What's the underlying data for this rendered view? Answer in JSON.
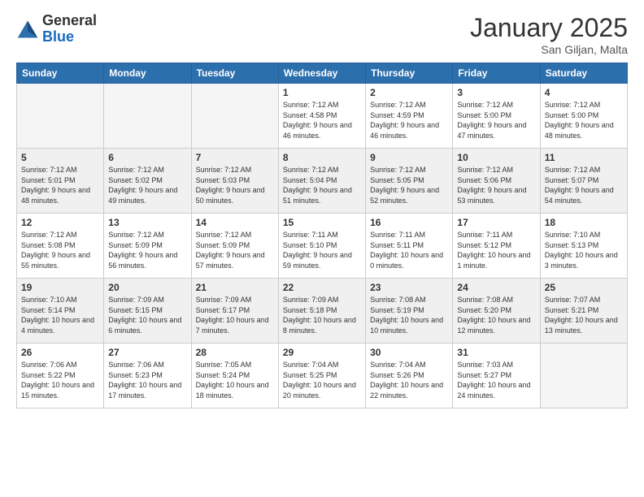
{
  "header": {
    "logo_line1": "General",
    "logo_line2": "Blue",
    "title": "January 2025",
    "subtitle": "San Giljan, Malta"
  },
  "weekdays": [
    "Sunday",
    "Monday",
    "Tuesday",
    "Wednesday",
    "Thursday",
    "Friday",
    "Saturday"
  ],
  "weeks": [
    [
      {
        "day": "",
        "sunrise": "",
        "sunset": "",
        "daylight": "",
        "empty": true
      },
      {
        "day": "",
        "sunrise": "",
        "sunset": "",
        "daylight": "",
        "empty": true
      },
      {
        "day": "",
        "sunrise": "",
        "sunset": "",
        "daylight": "",
        "empty": true
      },
      {
        "day": "1",
        "sunrise": "Sunrise: 7:12 AM",
        "sunset": "Sunset: 4:58 PM",
        "daylight": "Daylight: 9 hours and 46 minutes.",
        "empty": false
      },
      {
        "day": "2",
        "sunrise": "Sunrise: 7:12 AM",
        "sunset": "Sunset: 4:59 PM",
        "daylight": "Daylight: 9 hours and 46 minutes.",
        "empty": false
      },
      {
        "day": "3",
        "sunrise": "Sunrise: 7:12 AM",
        "sunset": "Sunset: 5:00 PM",
        "daylight": "Daylight: 9 hours and 47 minutes.",
        "empty": false
      },
      {
        "day": "4",
        "sunrise": "Sunrise: 7:12 AM",
        "sunset": "Sunset: 5:00 PM",
        "daylight": "Daylight: 9 hours and 48 minutes.",
        "empty": false
      }
    ],
    [
      {
        "day": "5",
        "sunrise": "Sunrise: 7:12 AM",
        "sunset": "Sunset: 5:01 PM",
        "daylight": "Daylight: 9 hours and 48 minutes.",
        "empty": false
      },
      {
        "day": "6",
        "sunrise": "Sunrise: 7:12 AM",
        "sunset": "Sunset: 5:02 PM",
        "daylight": "Daylight: 9 hours and 49 minutes.",
        "empty": false
      },
      {
        "day": "7",
        "sunrise": "Sunrise: 7:12 AM",
        "sunset": "Sunset: 5:03 PM",
        "daylight": "Daylight: 9 hours and 50 minutes.",
        "empty": false
      },
      {
        "day": "8",
        "sunrise": "Sunrise: 7:12 AM",
        "sunset": "Sunset: 5:04 PM",
        "daylight": "Daylight: 9 hours and 51 minutes.",
        "empty": false
      },
      {
        "day": "9",
        "sunrise": "Sunrise: 7:12 AM",
        "sunset": "Sunset: 5:05 PM",
        "daylight": "Daylight: 9 hours and 52 minutes.",
        "empty": false
      },
      {
        "day": "10",
        "sunrise": "Sunrise: 7:12 AM",
        "sunset": "Sunset: 5:06 PM",
        "daylight": "Daylight: 9 hours and 53 minutes.",
        "empty": false
      },
      {
        "day": "11",
        "sunrise": "Sunrise: 7:12 AM",
        "sunset": "Sunset: 5:07 PM",
        "daylight": "Daylight: 9 hours and 54 minutes.",
        "empty": false
      }
    ],
    [
      {
        "day": "12",
        "sunrise": "Sunrise: 7:12 AM",
        "sunset": "Sunset: 5:08 PM",
        "daylight": "Daylight: 9 hours and 55 minutes.",
        "empty": false
      },
      {
        "day": "13",
        "sunrise": "Sunrise: 7:12 AM",
        "sunset": "Sunset: 5:09 PM",
        "daylight": "Daylight: 9 hours and 56 minutes.",
        "empty": false
      },
      {
        "day": "14",
        "sunrise": "Sunrise: 7:12 AM",
        "sunset": "Sunset: 5:09 PM",
        "daylight": "Daylight: 9 hours and 57 minutes.",
        "empty": false
      },
      {
        "day": "15",
        "sunrise": "Sunrise: 7:11 AM",
        "sunset": "Sunset: 5:10 PM",
        "daylight": "Daylight: 9 hours and 59 minutes.",
        "empty": false
      },
      {
        "day": "16",
        "sunrise": "Sunrise: 7:11 AM",
        "sunset": "Sunset: 5:11 PM",
        "daylight": "Daylight: 10 hours and 0 minutes.",
        "empty": false
      },
      {
        "day": "17",
        "sunrise": "Sunrise: 7:11 AM",
        "sunset": "Sunset: 5:12 PM",
        "daylight": "Daylight: 10 hours and 1 minute.",
        "empty": false
      },
      {
        "day": "18",
        "sunrise": "Sunrise: 7:10 AM",
        "sunset": "Sunset: 5:13 PM",
        "daylight": "Daylight: 10 hours and 3 minutes.",
        "empty": false
      }
    ],
    [
      {
        "day": "19",
        "sunrise": "Sunrise: 7:10 AM",
        "sunset": "Sunset: 5:14 PM",
        "daylight": "Daylight: 10 hours and 4 minutes.",
        "empty": false
      },
      {
        "day": "20",
        "sunrise": "Sunrise: 7:09 AM",
        "sunset": "Sunset: 5:15 PM",
        "daylight": "Daylight: 10 hours and 6 minutes.",
        "empty": false
      },
      {
        "day": "21",
        "sunrise": "Sunrise: 7:09 AM",
        "sunset": "Sunset: 5:17 PM",
        "daylight": "Daylight: 10 hours and 7 minutes.",
        "empty": false
      },
      {
        "day": "22",
        "sunrise": "Sunrise: 7:09 AM",
        "sunset": "Sunset: 5:18 PM",
        "daylight": "Daylight: 10 hours and 8 minutes.",
        "empty": false
      },
      {
        "day": "23",
        "sunrise": "Sunrise: 7:08 AM",
        "sunset": "Sunset: 5:19 PM",
        "daylight": "Daylight: 10 hours and 10 minutes.",
        "empty": false
      },
      {
        "day": "24",
        "sunrise": "Sunrise: 7:08 AM",
        "sunset": "Sunset: 5:20 PM",
        "daylight": "Daylight: 10 hours and 12 minutes.",
        "empty": false
      },
      {
        "day": "25",
        "sunrise": "Sunrise: 7:07 AM",
        "sunset": "Sunset: 5:21 PM",
        "daylight": "Daylight: 10 hours and 13 minutes.",
        "empty": false
      }
    ],
    [
      {
        "day": "26",
        "sunrise": "Sunrise: 7:06 AM",
        "sunset": "Sunset: 5:22 PM",
        "daylight": "Daylight: 10 hours and 15 minutes.",
        "empty": false
      },
      {
        "day": "27",
        "sunrise": "Sunrise: 7:06 AM",
        "sunset": "Sunset: 5:23 PM",
        "daylight": "Daylight: 10 hours and 17 minutes.",
        "empty": false
      },
      {
        "day": "28",
        "sunrise": "Sunrise: 7:05 AM",
        "sunset": "Sunset: 5:24 PM",
        "daylight": "Daylight: 10 hours and 18 minutes.",
        "empty": false
      },
      {
        "day": "29",
        "sunrise": "Sunrise: 7:04 AM",
        "sunset": "Sunset: 5:25 PM",
        "daylight": "Daylight: 10 hours and 20 minutes.",
        "empty": false
      },
      {
        "day": "30",
        "sunrise": "Sunrise: 7:04 AM",
        "sunset": "Sunset: 5:26 PM",
        "daylight": "Daylight: 10 hours and 22 minutes.",
        "empty": false
      },
      {
        "day": "31",
        "sunrise": "Sunrise: 7:03 AM",
        "sunset": "Sunset: 5:27 PM",
        "daylight": "Daylight: 10 hours and 24 minutes.",
        "empty": false
      },
      {
        "day": "",
        "sunrise": "",
        "sunset": "",
        "daylight": "",
        "empty": true
      }
    ]
  ]
}
